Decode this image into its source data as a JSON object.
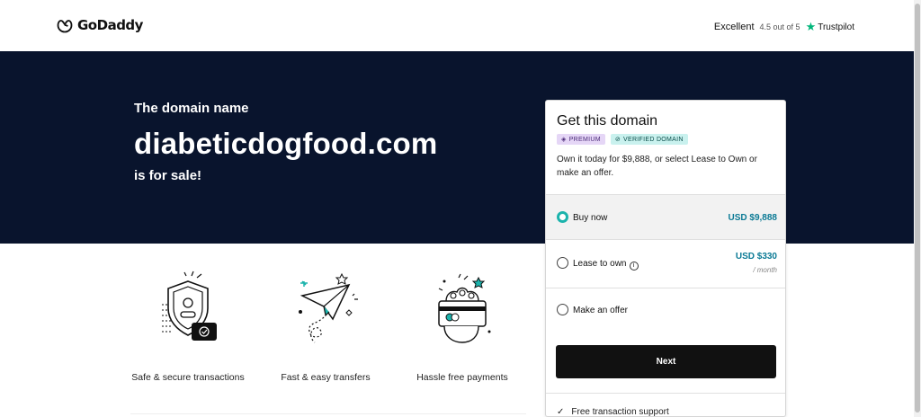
{
  "header": {
    "logo_text": "GoDaddy",
    "trust_label": "Excellent",
    "trust_score": "4.5 out of 5",
    "trust_brand": "Trustpilot"
  },
  "hero": {
    "subtitle": "The domain name",
    "domain": "diabeticdogfood.com",
    "sale_text": "is for sale!"
  },
  "features": [
    {
      "label": "Safe & secure transactions",
      "icon": "shield-lock-icon"
    },
    {
      "label": "Fast & easy transfers",
      "icon": "paper-plane-icon"
    },
    {
      "label": "Hassle free payments",
      "icon": "hand-card-icon"
    }
  ],
  "card": {
    "title": "Get this domain",
    "badge_premium": "PREMIUM",
    "badge_verified": "VERIFIED DOMAIN",
    "description": "Own it today for $9,888, or select Lease to Own or make an offer.",
    "options": [
      {
        "label": "Buy now",
        "price": "USD $9,888",
        "selected": true
      },
      {
        "label": "Lease to own",
        "price": "USD $330",
        "unit": "/ month",
        "selected": false
      },
      {
        "label": "Make an offer",
        "selected": false
      }
    ],
    "next_label": "Next",
    "support_text": "Free transaction support"
  },
  "colors": {
    "hero_bg": "#09142d",
    "accent_teal": "#1bb3ac",
    "price_blue": "#0b7a95",
    "trustpilot_green": "#00b67a"
  }
}
